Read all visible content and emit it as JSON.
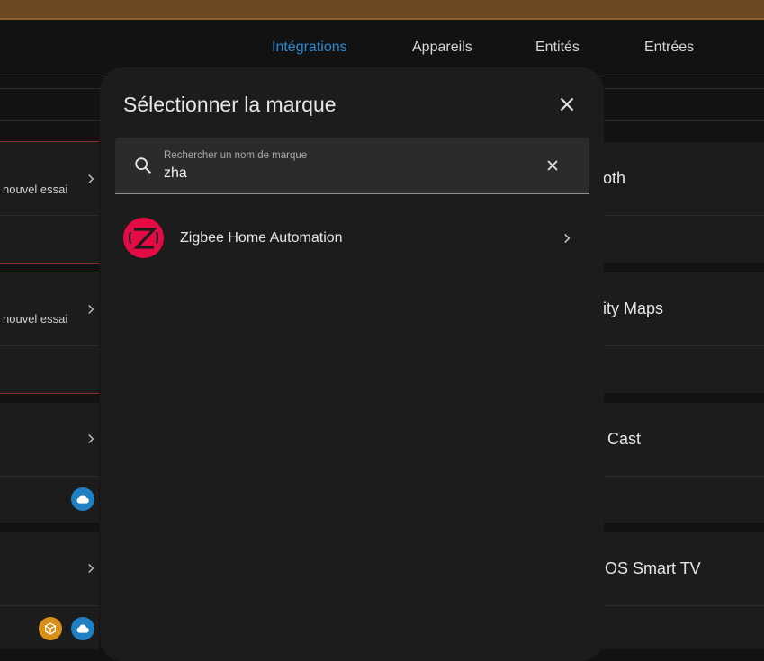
{
  "tabs": [
    "Intégrations",
    "Appareils",
    "Entités",
    "Entrées"
  ],
  "active_tab": "Intégrations",
  "background": {
    "retry_text_1": "nouvel essai",
    "retry_text_2": "nouvel essai",
    "right_text_1": "oth",
    "right_text_2": "ity Maps",
    "right_text_3": "Cast",
    "right_text_4": "OS Smart TV"
  },
  "dialog": {
    "title": "Sélectionner la marque",
    "search": {
      "label": "Rechercher un nom de marque",
      "value": "zha"
    },
    "results": [
      {
        "label": "Zigbee Home Automation",
        "icon": "zigbee-logo"
      }
    ]
  },
  "colors": {
    "accent": "#2a8ad4",
    "zigbee": "#e40a44",
    "cloud_badge": "#1f7fc2",
    "package_badge": "#d9901a"
  }
}
